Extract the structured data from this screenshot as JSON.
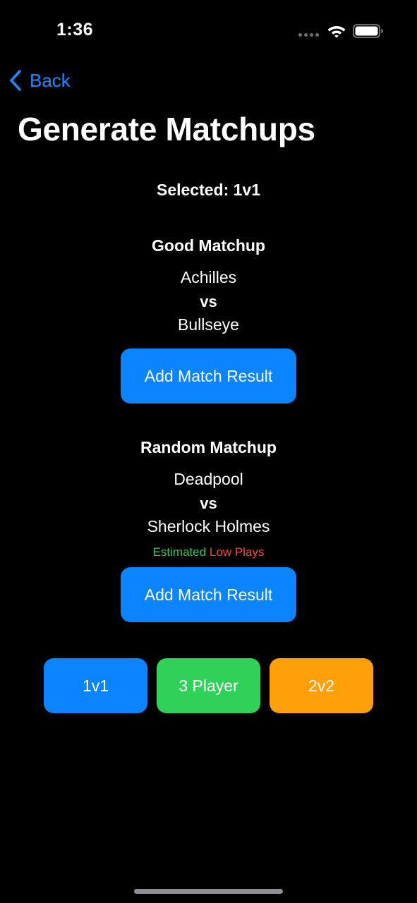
{
  "status_bar": {
    "time": "1:36"
  },
  "nav": {
    "back_label": "Back"
  },
  "page": {
    "title": "Generate Matchups"
  },
  "selection": {
    "text": "Selected: 1v1"
  },
  "good_matchup": {
    "heading": "Good Matchup",
    "player_one": "Achilles",
    "vs": "vs",
    "player_two": "Bullseye",
    "button_label": "Add Match Result"
  },
  "random_matchup": {
    "heading": "Random Matchup",
    "player_one": "Deadpool",
    "vs": "vs",
    "player_two": "Sherlock Holmes",
    "estimate_prefix": "Estimated",
    "estimate_value": "Low Plays",
    "button_label": "Add Match Result"
  },
  "modes": [
    {
      "label": "1v1",
      "color": "#0a84ff"
    },
    {
      "label": "3 Player",
      "color": "#30d158"
    },
    {
      "label": "2v2",
      "color": "#ff9f0a"
    }
  ],
  "colors": {
    "accent": "#0a84ff",
    "estimate_prefix": "#34c759",
    "estimate_value": "#ff453a",
    "background": "#000000"
  },
  "icons": {
    "back": "chevron-left-icon",
    "wifi": "wifi-icon",
    "battery": "battery-icon",
    "signal": "signal-dots-icon"
  }
}
